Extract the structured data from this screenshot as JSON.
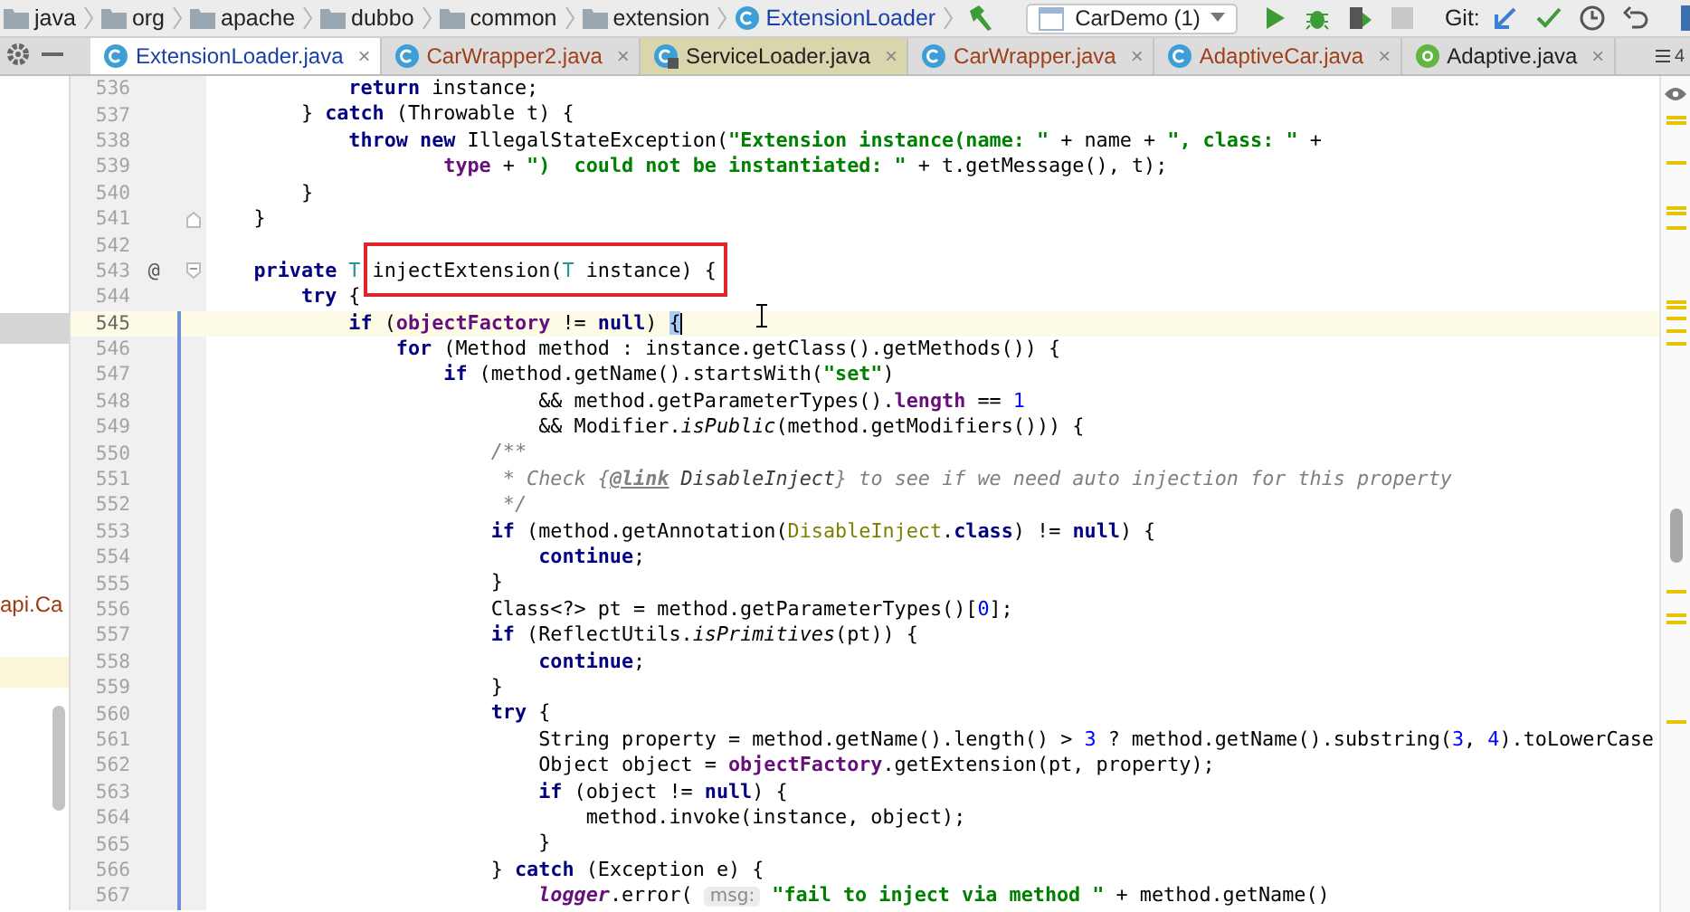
{
  "breadcrumbs": [
    {
      "kind": "folder",
      "label": "java"
    },
    {
      "kind": "folder",
      "label": "org"
    },
    {
      "kind": "folder",
      "label": "apache"
    },
    {
      "kind": "folder",
      "label": "dubbo"
    },
    {
      "kind": "folder",
      "label": "common"
    },
    {
      "kind": "folder",
      "label": "extension"
    },
    {
      "kind": "class",
      "label": "ExtensionLoader"
    }
  ],
  "toolbar": {
    "run_config": "CarDemo (1)",
    "git_label": "Git:"
  },
  "tabs": [
    {
      "label": "ExtensionLoader.java",
      "kind": "class",
      "selected": true,
      "color": "#1b3fa8",
      "library": false,
      "close": "×"
    },
    {
      "label": "CarWrapper2.java",
      "kind": "class",
      "selected": false,
      "color": "#a0401a",
      "library": false,
      "close": "×"
    },
    {
      "label": "ServiceLoader.java",
      "kind": "locked-class",
      "selected": false,
      "color": "#222222",
      "library": true,
      "close": "×"
    },
    {
      "label": "CarWrapper.java",
      "kind": "class",
      "selected": false,
      "color": "#a0401a",
      "library": false,
      "close": "×"
    },
    {
      "label": "AdaptiveCar.java",
      "kind": "class",
      "selected": false,
      "color": "#a0401a",
      "library": false,
      "close": "×"
    },
    {
      "label": "Adaptive.java",
      "kind": "annotation",
      "selected": false,
      "color": "#222222",
      "library": false,
      "close": "×"
    }
  ],
  "tab_count": "4",
  "project_tree": [
    {
      "selected": true,
      "highlighted": false
    },
    {
      "label": "api.Ca",
      "selected": false,
      "highlighted": false
    },
    {
      "selected": false,
      "highlighted": true
    }
  ],
  "editor": {
    "lines": [
      {
        "number": "536",
        "segments": [
          {
            "kind": "keyword",
            "text": "            return"
          },
          {
            "kind": "plain",
            "text": " instance;"
          }
        ]
      },
      {
        "number": "537",
        "segments": [
          {
            "kind": "plain",
            "text": "        } "
          },
          {
            "kind": "keyword",
            "text": "catch"
          },
          {
            "kind": "plain",
            "text": " (Throwable t) {"
          }
        ]
      },
      {
        "number": "538",
        "segments": [
          {
            "kind": "keyword",
            "text": "            throw new"
          },
          {
            "kind": "plain",
            "text": " IllegalStateException("
          },
          {
            "kind": "string",
            "text": "\"Extension instance(name: \""
          },
          {
            "kind": "plain",
            "text": " + name + "
          },
          {
            "kind": "string",
            "text": "\", class: \""
          },
          {
            "kind": "plain",
            "text": " +"
          }
        ]
      },
      {
        "number": "539",
        "segments": [
          {
            "kind": "field",
            "text": "                    type"
          },
          {
            "kind": "plain",
            "text": " + "
          },
          {
            "kind": "string",
            "text": "\")  could not be instantiated: \""
          },
          {
            "kind": "plain",
            "text": " + t.getMessage(), t);"
          }
        ]
      },
      {
        "number": "540",
        "segments": [
          {
            "kind": "plain",
            "text": "        }"
          }
        ]
      },
      {
        "number": "541",
        "fold_end": true,
        "segments": [
          {
            "kind": "plain",
            "text": "    }"
          }
        ]
      },
      {
        "number": "542"
      },
      {
        "number": "543",
        "fold_start": true,
        "gutter_mark": "@",
        "segments": [
          {
            "kind": "keyword",
            "text": "    private"
          },
          {
            "kind": "typeparam",
            "text": " T "
          },
          {
            "kind": "plain",
            "text": "injectExtension(",
            "boxed": true
          },
          {
            "kind": "typeparam",
            "text": "T",
            "boxed": true
          },
          {
            "kind": "plain",
            "text": " instance) {",
            "boxed": true
          }
        ]
      },
      {
        "number": "544",
        "segments": [
          {
            "kind": "keyword",
            "text": "        try"
          },
          {
            "kind": "plain",
            "text": " {"
          }
        ]
      },
      {
        "number": "545",
        "current": true,
        "changed": true,
        "segments": [
          {
            "kind": "keyword",
            "text": "            if"
          },
          {
            "kind": "plain",
            "text": " ("
          },
          {
            "kind": "field",
            "text": "objectFactory"
          },
          {
            "kind": "plain",
            "text": " != "
          },
          {
            "kind": "keyword",
            "text": "null"
          },
          {
            "kind": "plain",
            "text": ") "
          },
          {
            "kind": "brace-match",
            "text": "{"
          }
        ]
      },
      {
        "number": "546",
        "changed": true,
        "segments": [
          {
            "kind": "keyword",
            "text": "                for"
          },
          {
            "kind": "plain",
            "text": " (Method method : instance.getClass().getMethods()) {"
          }
        ]
      },
      {
        "number": "547",
        "changed": true,
        "segments": [
          {
            "kind": "keyword",
            "text": "                    if"
          },
          {
            "kind": "plain",
            "text": " (method.getName().startsWith("
          },
          {
            "kind": "string",
            "text": "\"set\""
          },
          {
            "kind": "plain",
            "text": ")"
          }
        ]
      },
      {
        "number": "548",
        "changed": true,
        "segments": [
          {
            "kind": "plain",
            "text": "                            && method.getParameterTypes()."
          },
          {
            "kind": "field",
            "text": "length"
          },
          {
            "kind": "plain",
            "text": " == "
          },
          {
            "kind": "number",
            "text": "1"
          }
        ]
      },
      {
        "number": "549",
        "changed": true,
        "segments": [
          {
            "kind": "plain",
            "text": "                            && Modifier."
          },
          {
            "kind": "static",
            "text": "isPublic"
          },
          {
            "kind": "plain",
            "text": "(method.getModifiers())) {"
          }
        ]
      },
      {
        "number": "550",
        "changed": true,
        "segments": [
          {
            "kind": "doc",
            "text": "                        /**"
          }
        ]
      },
      {
        "number": "551",
        "changed": true,
        "segments": [
          {
            "kind": "doc",
            "text": "                         * Check {"
          },
          {
            "kind": "doctag",
            "text": "@link"
          },
          {
            "kind": "docref",
            "text": " DisableInject"
          },
          {
            "kind": "doc",
            "text": "} to see if we need auto injection for this property"
          }
        ]
      },
      {
        "number": "552",
        "changed": true,
        "segments": [
          {
            "kind": "doc",
            "text": "                         */"
          }
        ]
      },
      {
        "number": "553",
        "changed": true,
        "segments": [
          {
            "kind": "keyword",
            "text": "                        if"
          },
          {
            "kind": "plain",
            "text": " (method.getAnnotation("
          },
          {
            "kind": "classref",
            "text": "DisableInject"
          },
          {
            "kind": "plain",
            "text": "."
          },
          {
            "kind": "keyword",
            "text": "class"
          },
          {
            "kind": "plain",
            "text": ") != "
          },
          {
            "kind": "keyword",
            "text": "null"
          },
          {
            "kind": "plain",
            "text": ") {"
          }
        ]
      },
      {
        "number": "554",
        "changed": true,
        "segments": [
          {
            "kind": "keyword",
            "text": "                            continue"
          },
          {
            "kind": "plain",
            "text": ";"
          }
        ]
      },
      {
        "number": "555",
        "changed": true,
        "segments": [
          {
            "kind": "plain",
            "text": "                        }"
          }
        ]
      },
      {
        "number": "556",
        "changed": true,
        "segments": [
          {
            "kind": "plain",
            "text": "                        Class<?> pt = method.getParameterTypes()["
          },
          {
            "kind": "number",
            "text": "0"
          },
          {
            "kind": "plain",
            "text": "];"
          }
        ]
      },
      {
        "number": "557",
        "changed": true,
        "segments": [
          {
            "kind": "keyword",
            "text": "                        if"
          },
          {
            "kind": "plain",
            "text": " (ReflectUtils."
          },
          {
            "kind": "static",
            "text": "isPrimitives"
          },
          {
            "kind": "plain",
            "text": "(pt)) {"
          }
        ]
      },
      {
        "number": "558",
        "changed": true,
        "segments": [
          {
            "kind": "keyword",
            "text": "                            continue"
          },
          {
            "kind": "plain",
            "text": ";"
          }
        ]
      },
      {
        "number": "559",
        "changed": true,
        "segments": [
          {
            "kind": "plain",
            "text": "                        }"
          }
        ]
      },
      {
        "number": "560",
        "changed": true,
        "segments": [
          {
            "kind": "keyword",
            "text": "                        try"
          },
          {
            "kind": "plain",
            "text": " {"
          }
        ]
      },
      {
        "number": "561",
        "changed": true,
        "segments": [
          {
            "kind": "plain",
            "text": "                            String property = method.getName().length() > "
          },
          {
            "kind": "number",
            "text": "3"
          },
          {
            "kind": "plain",
            "text": " ? method.getName().substring("
          },
          {
            "kind": "number",
            "text": "3"
          },
          {
            "kind": "plain",
            "text": ", "
          },
          {
            "kind": "number",
            "text": "4"
          },
          {
            "kind": "plain",
            "text": ").toLowerCase"
          }
        ]
      },
      {
        "number": "562",
        "changed": true,
        "segments": [
          {
            "kind": "plain",
            "text": "                            Object object = "
          },
          {
            "kind": "field",
            "text": "objectFactory"
          },
          {
            "kind": "plain",
            "text": ".getExtension(pt, property);"
          }
        ]
      },
      {
        "number": "563",
        "changed": true,
        "segments": [
          {
            "kind": "keyword",
            "text": "                            if"
          },
          {
            "kind": "plain",
            "text": " (object != "
          },
          {
            "kind": "keyword",
            "text": "null"
          },
          {
            "kind": "plain",
            "text": ") {"
          }
        ]
      },
      {
        "number": "564",
        "changed": true,
        "segments": [
          {
            "kind": "plain",
            "text": "                                method.invoke(instance, object);"
          }
        ]
      },
      {
        "number": "565",
        "changed": true,
        "segments": [
          {
            "kind": "plain",
            "text": "                            }"
          }
        ]
      },
      {
        "number": "566",
        "changed": true,
        "segments": [
          {
            "kind": "plain",
            "text": "                        } "
          },
          {
            "kind": "keyword",
            "text": "catch"
          },
          {
            "kind": "plain",
            "text": " (Exception e) {"
          }
        ]
      },
      {
        "number": "567",
        "changed": true,
        "segments": [
          {
            "kind": "staticfield",
            "text": "                            logger"
          },
          {
            "kind": "plain",
            "text": ".error( "
          },
          {
            "kind": "hint",
            "text": "msg:"
          },
          {
            "kind": "string",
            "text": " \"fail to inject via method \""
          },
          {
            "kind": "plain",
            "text": " + method.getName()"
          }
        ]
      }
    ]
  }
}
